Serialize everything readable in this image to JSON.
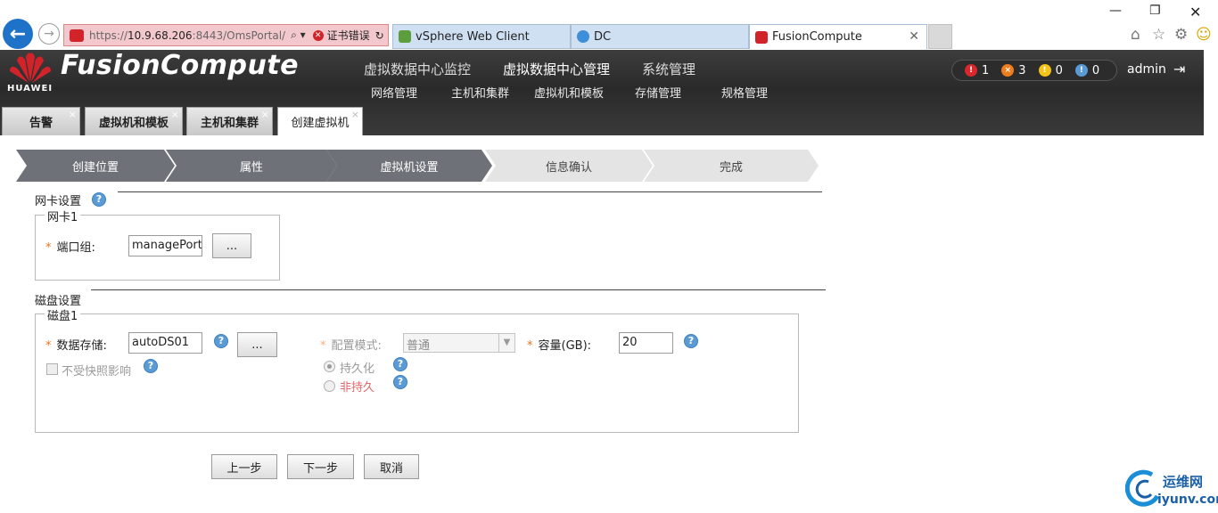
{
  "browser": {
    "url_dim": "https://",
    "url_host": "10.9.68.206",
    "url_rest": ":8443/OmsPortal/",
    "search_glyph": "⌕ ▾",
    "cert_error": "证书错误",
    "refresh_glyph": "↻",
    "tabs": [
      {
        "label": "vSphere Web Client",
        "icon": "vsphere-icon"
      },
      {
        "label": "DC",
        "icon": "ie-icon"
      },
      {
        "label": "FusionCompute",
        "icon": "huawei-icon"
      }
    ],
    "close_glyph": "✕",
    "window_controls": {
      "minimize": "—",
      "restore": "❐",
      "close": "✕"
    },
    "toolbar_icons": {
      "home": "⌂",
      "favorites": "☆",
      "settings": "⚙",
      "smiley": "☺"
    }
  },
  "app": {
    "brand": "HUAWEI",
    "title": "FusionCompute",
    "top_nav": [
      "虚拟数据中心监控",
      "虚拟数据中心管理",
      "系统管理"
    ],
    "sub_nav": [
      "网络管理",
      "主机和集群",
      "虚拟机和模板",
      "存储管理",
      "规格管理"
    ],
    "alarms": [
      {
        "count": "1",
        "color": "#d9272e",
        "glyph": "!"
      },
      {
        "count": "3",
        "color": "#f07c1b",
        "glyph": "×"
      },
      {
        "count": "0",
        "color": "#f2c318",
        "glyph": "!"
      },
      {
        "count": "0",
        "color": "#5b9bd5",
        "glyph": "!"
      }
    ],
    "user": "admin",
    "logout_glyph": "⇥"
  },
  "page_tabs": [
    {
      "label": "告警"
    },
    {
      "label": "虚拟机和模板"
    },
    {
      "label": "主机和集群"
    },
    {
      "label": "创建虚拟机"
    }
  ],
  "page_tab_close": "×",
  "steps": [
    {
      "label": "创建位置",
      "state": "done"
    },
    {
      "label": "属性",
      "state": "done"
    },
    {
      "label": "虚拟机设置",
      "state": "current"
    },
    {
      "label": "信息确认",
      "state": "todo"
    },
    {
      "label": "完成",
      "state": "todo"
    }
  ],
  "nic": {
    "section_title": "网卡设置",
    "legend": "网卡1",
    "required": "*",
    "port_group_label": "端口组:",
    "port_group_value": "managePortgroup",
    "browse": "..."
  },
  "disk": {
    "section_title": "磁盘设置",
    "legend": "磁盘1",
    "required": "*",
    "datastore_label": "数据存储:",
    "datastore_value": "autoDS01",
    "browse": "...",
    "config_mode_label": "配置模式:",
    "config_mode_value": "普通",
    "capacity_label": "容量(GB):",
    "capacity_value": "20",
    "snapshot_label": "不受快照影响",
    "persistent_label": "持久化",
    "nonpersistent_label": "非持久"
  },
  "help_glyph": "?",
  "actions": {
    "prev": "上一步",
    "next": "下一步",
    "cancel": "取消"
  },
  "watermark": {
    "line1": "运维网",
    "line2": "iyunv.com"
  }
}
